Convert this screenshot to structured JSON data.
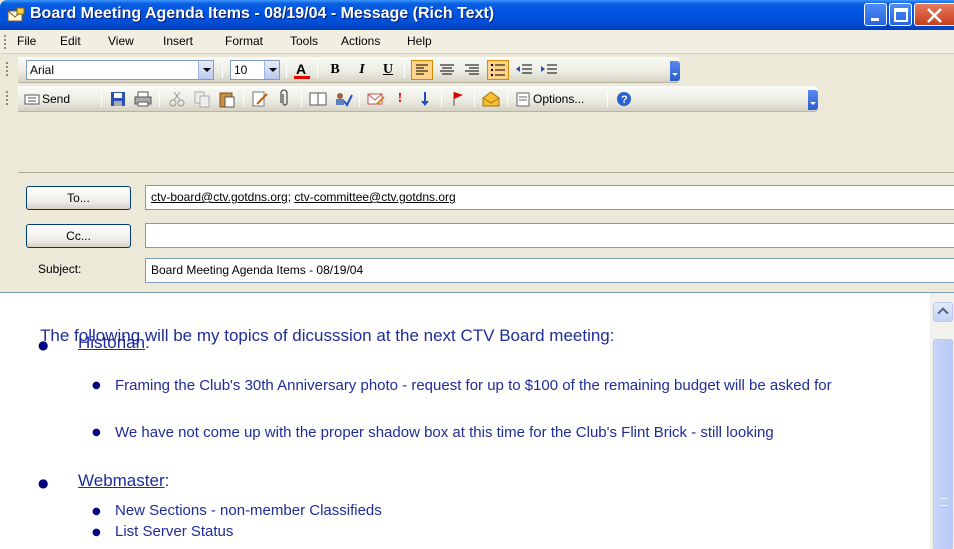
{
  "window": {
    "title": "Board Meeting Agenda Items - 08/19/04  - Message (Rich Text)"
  },
  "menu": [
    "File",
    "Edit",
    "View",
    "Insert",
    "Format",
    "Tools",
    "Actions",
    "Help"
  ],
  "format_toolbar": {
    "font": "Arial",
    "size": "10"
  },
  "standard_toolbar": {
    "send_label": "Send",
    "options_label": "Options..."
  },
  "header": {
    "to_button": "To...",
    "cc_button": "Cc...",
    "subject_label": "Subject:",
    "to_recipients": [
      "ctv-board@ctv.gotdns.org",
      "ctv-committee@ctv.gotdns.org"
    ],
    "to_separator": "; ",
    "cc_value": "",
    "subject_value": "Board Meeting Agenda Items - 08/19/04"
  },
  "body": {
    "intro": "The following will be my topics of dicusssion at the next CTV Board meeting:",
    "sections": [
      {
        "title": "Historian",
        "suffix": ":",
        "items": [
          "Framing the Club's 30th Anniversary photo - request for up to $100 of the remaining budget will be asked for",
          "We have not come up with the proper shadow box at this time for the Club's Flint Brick - still looking"
        ]
      },
      {
        "title": "Webmaster",
        "suffix": ":",
        "items": [
          "New Sections - non-member Classifieds",
          "List Server Status"
        ]
      }
    ]
  },
  "colors": {
    "titlebar": "#0054e3",
    "body_text": "#1f2c9a",
    "active_button": "#ffd48a"
  }
}
